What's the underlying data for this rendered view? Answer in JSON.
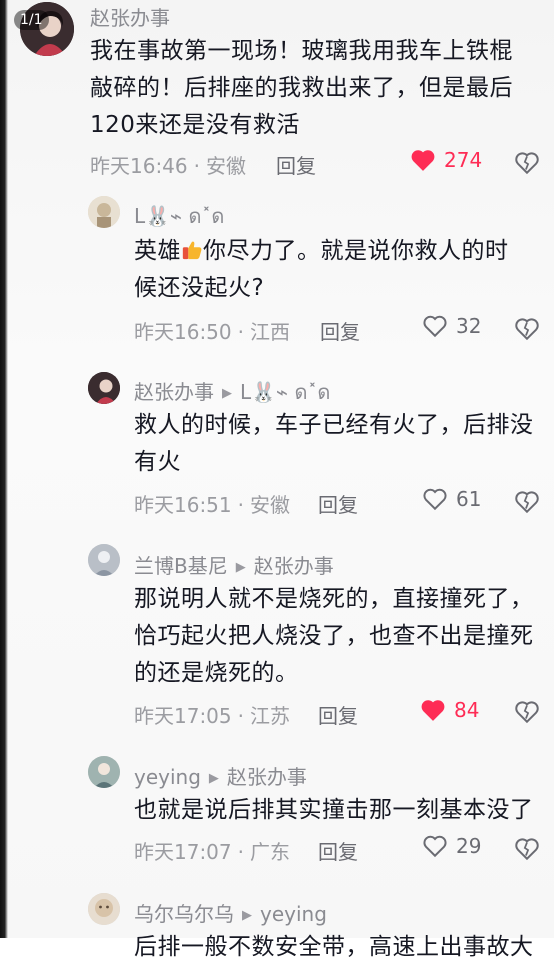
{
  "pager": "1/1",
  "comments": [
    {
      "author": "赵张办事",
      "body_lines": [
        "我在事故第一现场！玻璃我用我车上铁棍",
        "敲碎的！后排座的我救出来了，但是最后",
        "120来还是没有救活"
      ],
      "time": "昨天16:46",
      "region": "安徽",
      "reply": "回复",
      "likes": "274",
      "liked": true
    },
    {
      "author": "L🐰⌁ ด˟ด",
      "body_pre": "英雄",
      "body_post": "你尽力了。就是说你救人的时",
      "body_line2": "候还没起火?",
      "time": "昨天16:50",
      "region": "江西",
      "reply": "回复",
      "likes": "32",
      "liked": false
    },
    {
      "author": "赵张办事",
      "reply_to": "L🐰⌁ ด˟ด",
      "body_lines": [
        "救人的时候，车子已经有火了，后排没",
        "有火"
      ],
      "time": "昨天16:51",
      "region": "安徽",
      "reply": "回复",
      "likes": "61",
      "liked": false
    },
    {
      "author": "兰博B基尼",
      "reply_to": "赵张办事",
      "body_lines": [
        "那说明人就不是烧死的，直接撞死了，",
        "恰巧起火把人烧没了，也查不出是撞死",
        "的还是烧死的。"
      ],
      "time": "昨天17:05",
      "region": "江苏",
      "reply": "回复",
      "likes": "84",
      "liked": true
    },
    {
      "author": "yeying",
      "reply_to": "赵张办事",
      "body_lines": [
        "也就是说后排其实撞击那一刻基本没了"
      ],
      "time": "昨天17:07",
      "region": "广东",
      "reply": "回复",
      "likes": "29",
      "liked": false
    },
    {
      "author": "乌尔乌尔乌",
      "reply_to": "yeying",
      "body_lines": [
        "后排一般不数安全带，高速上出事故大"
      ]
    }
  ],
  "colors": {
    "like_red": "#fe2c55",
    "meta_gray": "#9b9ca1",
    "name_gray": "#8a8b91"
  }
}
